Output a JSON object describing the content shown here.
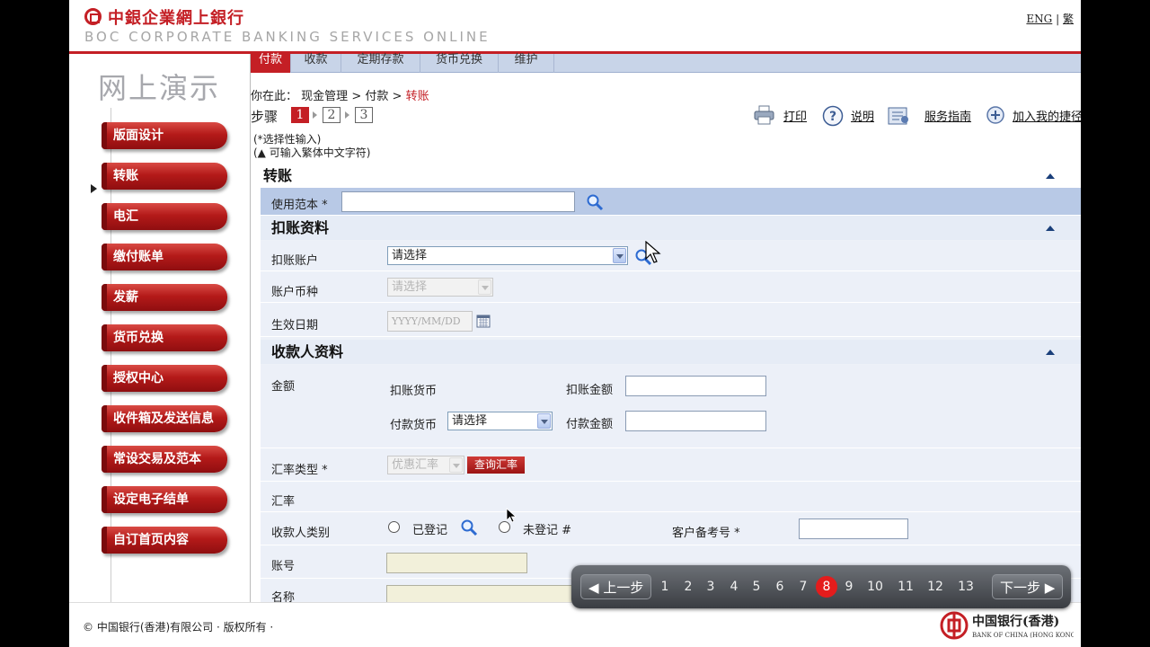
{
  "header": {
    "brand_cn": "中銀企業網上銀行",
    "brand_en": "BOC CORPORATE BANKING SERVICES ONLINE",
    "lang_eng": "ENG",
    "lang_sep": "|",
    "lang_trad": "繁"
  },
  "sidebar": {
    "title": "网上演示",
    "items": [
      {
        "label": "版面设计"
      },
      {
        "label": "转账"
      },
      {
        "label": "电汇"
      },
      {
        "label": "缴付账单"
      },
      {
        "label": "发薪"
      },
      {
        "label": "货币兑换"
      },
      {
        "label": "授权中心"
      },
      {
        "label": "收件箱及发送信息"
      },
      {
        "label": "常设交易及范本"
      },
      {
        "label": "设定电子结单"
      },
      {
        "label": "自订首页内容"
      }
    ]
  },
  "tabs": [
    {
      "label": "付款"
    },
    {
      "label": "收款"
    },
    {
      "label": "定期存款"
    },
    {
      "label": "货币兑换"
    },
    {
      "label": "维护"
    }
  ],
  "breadcrumb": {
    "prefix": "你在此：",
    "l1": "现金管理",
    "sep": ">",
    "l2": "付款",
    "current": "转账"
  },
  "steps": {
    "label": "步骤",
    "items": [
      "1",
      "2",
      "3"
    ],
    "active": "1"
  },
  "tools": {
    "print": "打印",
    "help": "说明",
    "guide": "服务指南",
    "add": "加入我的捷径"
  },
  "notes": {
    "optional": "(*选择性输入)",
    "trad_chinese": "(▲ 可输入繁体中文字符)"
  },
  "form": {
    "transfer_title": "转账",
    "template_label": "使用范本 *",
    "template_value": "",
    "debit_section": "扣账资料",
    "debit_account_label": "扣账账户",
    "debit_account_value": "请选择",
    "account_currency_label": "账户币种",
    "account_currency_value": "请选择",
    "effective_date_label": "生效日期",
    "effective_date_placeholder": "YYYY/MM/DD",
    "payee_section": "收款人资料",
    "amount_label": "金额",
    "debit_currency_label": "扣账货币",
    "debit_amount_label": "扣账金额",
    "debit_amount_value": "",
    "pay_currency_label": "付款货币",
    "pay_currency_value": "请选择",
    "pay_amount_label": "付款金额",
    "pay_amount_value": "",
    "rate_type_label": "汇率类型 *",
    "rate_type_value": "优惠汇率",
    "query_rate_button": "查询汇率",
    "rate_label": "汇率",
    "payee_type_label": "收款人类别",
    "registered_label": "已登记",
    "unregistered_label": "未登记 #",
    "customer_ref_label": "客户备考号 *",
    "customer_ref_value": "",
    "account_no_label": "账号",
    "account_no_value": "",
    "name_label": "名称",
    "name_value": ""
  },
  "pager": {
    "prev": "上一步",
    "next": "下一步",
    "pages": [
      "1",
      "2",
      "3",
      "4",
      "5",
      "6",
      "7",
      "8",
      "9",
      "10",
      "11",
      "12",
      "13"
    ],
    "current": "8"
  },
  "footer": {
    "copyright": "© 中国银行(香港)有限公司 · 版权所有 ·",
    "logo_cn": "中国银行(香港)",
    "logo_en": "BANK OF CHINA (HONG KONG)"
  },
  "colors": {
    "brand_red": "#c41f25",
    "tab_bar": "#c8d4e8",
    "form_bg": "#edf1f8",
    "section_head": "#e6ecf6",
    "pager_active": "#e41c1c"
  }
}
